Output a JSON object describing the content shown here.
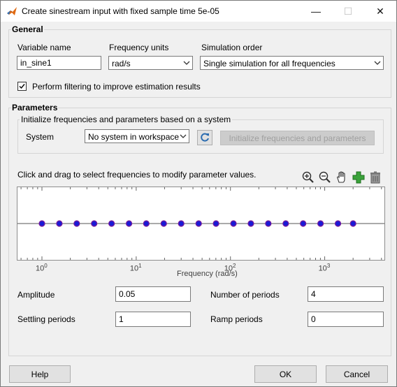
{
  "window": {
    "title": "Create sinestream input with fixed sample time 5e-05",
    "minimize": "—",
    "maximize": "☐",
    "close": "✕"
  },
  "general": {
    "title": "General",
    "variable_name_label": "Variable name",
    "variable_name_value": "in_sine1",
    "frequency_units_label": "Frequency units",
    "frequency_units_value": "rad/s",
    "simulation_order_label": "Simulation order",
    "simulation_order_value": "Single simulation for all frequencies",
    "filtering_label": "Perform filtering to improve estimation results",
    "filtering_checked": true
  },
  "parameters": {
    "title": "Parameters",
    "init_group_title": "Initialize frequencies and parameters based on a system",
    "system_label": "System",
    "system_value": "No system in workspace",
    "init_button": "Initialize frequencies and parameters",
    "instructions": "Click and drag to select frequencies to modify parameter values.",
    "toolbar": [
      "zoom-in-icon",
      "zoom-out-icon",
      "pan-hand-icon",
      "add-icon",
      "delete-icon"
    ],
    "amplitude_label": "Amplitude",
    "amplitude_value": "0.05",
    "num_periods_label": "Number of periods",
    "num_periods_value": "4",
    "settling_label": "Settling periods",
    "settling_value": "1",
    "ramp_label": "Ramp periods",
    "ramp_value": "0"
  },
  "chart_data": {
    "type": "scatter",
    "xlabel": "Frequency (rad/s)",
    "xscale": "log",
    "xlim": [
      0.55,
      4300
    ],
    "x_ticks": [
      1,
      10,
      100,
      1000
    ],
    "x_tick_labels": [
      [
        "10",
        "0"
      ],
      [
        "10",
        "1"
      ],
      [
        "10",
        "2"
      ],
      [
        "10",
        "3"
      ]
    ],
    "ylim": [
      -1,
      1
    ],
    "x": [
      1,
      1.53,
      2.34,
      3.58,
      5.48,
      8.39,
      12.8,
      19.6,
      30.0,
      46.0,
      70.3,
      107.6,
      164.7,
      252,
      386,
      590,
      903,
      1382,
      2000
    ],
    "y": [
      0,
      0,
      0,
      0,
      0,
      0,
      0,
      0,
      0,
      0,
      0,
      0,
      0,
      0,
      0,
      0,
      0,
      0,
      0
    ],
    "marker_color": "#1a1ad6",
    "marker_edge": "#7a1a9a",
    "line_color": "#555555"
  },
  "footer": {
    "help": "Help",
    "ok": "OK",
    "cancel": "Cancel"
  }
}
